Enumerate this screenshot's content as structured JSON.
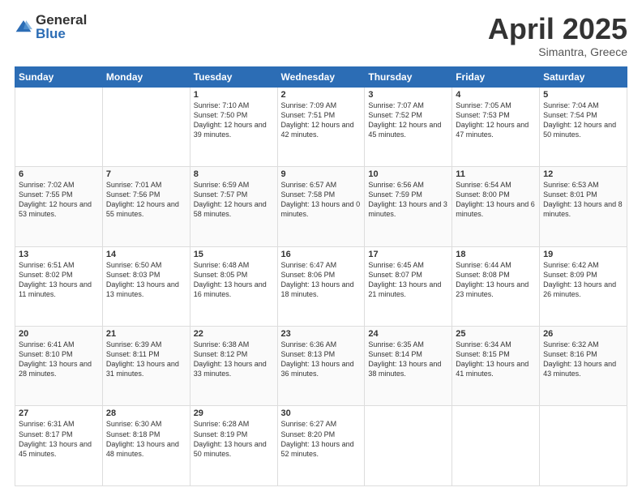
{
  "header": {
    "logo_general": "General",
    "logo_blue": "Blue",
    "title": "April 2025",
    "location": "Simantra, Greece"
  },
  "days_of_week": [
    "Sunday",
    "Monday",
    "Tuesday",
    "Wednesday",
    "Thursday",
    "Friday",
    "Saturday"
  ],
  "weeks": [
    [
      {
        "day": "",
        "info": ""
      },
      {
        "day": "",
        "info": ""
      },
      {
        "day": "1",
        "info": "Sunrise: 7:10 AM\nSunset: 7:50 PM\nDaylight: 12 hours and 39 minutes."
      },
      {
        "day": "2",
        "info": "Sunrise: 7:09 AM\nSunset: 7:51 PM\nDaylight: 12 hours and 42 minutes."
      },
      {
        "day": "3",
        "info": "Sunrise: 7:07 AM\nSunset: 7:52 PM\nDaylight: 12 hours and 45 minutes."
      },
      {
        "day": "4",
        "info": "Sunrise: 7:05 AM\nSunset: 7:53 PM\nDaylight: 12 hours and 47 minutes."
      },
      {
        "day": "5",
        "info": "Sunrise: 7:04 AM\nSunset: 7:54 PM\nDaylight: 12 hours and 50 minutes."
      }
    ],
    [
      {
        "day": "6",
        "info": "Sunrise: 7:02 AM\nSunset: 7:55 PM\nDaylight: 12 hours and 53 minutes."
      },
      {
        "day": "7",
        "info": "Sunrise: 7:01 AM\nSunset: 7:56 PM\nDaylight: 12 hours and 55 minutes."
      },
      {
        "day": "8",
        "info": "Sunrise: 6:59 AM\nSunset: 7:57 PM\nDaylight: 12 hours and 58 minutes."
      },
      {
        "day": "9",
        "info": "Sunrise: 6:57 AM\nSunset: 7:58 PM\nDaylight: 13 hours and 0 minutes."
      },
      {
        "day": "10",
        "info": "Sunrise: 6:56 AM\nSunset: 7:59 PM\nDaylight: 13 hours and 3 minutes."
      },
      {
        "day": "11",
        "info": "Sunrise: 6:54 AM\nSunset: 8:00 PM\nDaylight: 13 hours and 6 minutes."
      },
      {
        "day": "12",
        "info": "Sunrise: 6:53 AM\nSunset: 8:01 PM\nDaylight: 13 hours and 8 minutes."
      }
    ],
    [
      {
        "day": "13",
        "info": "Sunrise: 6:51 AM\nSunset: 8:02 PM\nDaylight: 13 hours and 11 minutes."
      },
      {
        "day": "14",
        "info": "Sunrise: 6:50 AM\nSunset: 8:03 PM\nDaylight: 13 hours and 13 minutes."
      },
      {
        "day": "15",
        "info": "Sunrise: 6:48 AM\nSunset: 8:05 PM\nDaylight: 13 hours and 16 minutes."
      },
      {
        "day": "16",
        "info": "Sunrise: 6:47 AM\nSunset: 8:06 PM\nDaylight: 13 hours and 18 minutes."
      },
      {
        "day": "17",
        "info": "Sunrise: 6:45 AM\nSunset: 8:07 PM\nDaylight: 13 hours and 21 minutes."
      },
      {
        "day": "18",
        "info": "Sunrise: 6:44 AM\nSunset: 8:08 PM\nDaylight: 13 hours and 23 minutes."
      },
      {
        "day": "19",
        "info": "Sunrise: 6:42 AM\nSunset: 8:09 PM\nDaylight: 13 hours and 26 minutes."
      }
    ],
    [
      {
        "day": "20",
        "info": "Sunrise: 6:41 AM\nSunset: 8:10 PM\nDaylight: 13 hours and 28 minutes."
      },
      {
        "day": "21",
        "info": "Sunrise: 6:39 AM\nSunset: 8:11 PM\nDaylight: 13 hours and 31 minutes."
      },
      {
        "day": "22",
        "info": "Sunrise: 6:38 AM\nSunset: 8:12 PM\nDaylight: 13 hours and 33 minutes."
      },
      {
        "day": "23",
        "info": "Sunrise: 6:36 AM\nSunset: 8:13 PM\nDaylight: 13 hours and 36 minutes."
      },
      {
        "day": "24",
        "info": "Sunrise: 6:35 AM\nSunset: 8:14 PM\nDaylight: 13 hours and 38 minutes."
      },
      {
        "day": "25",
        "info": "Sunrise: 6:34 AM\nSunset: 8:15 PM\nDaylight: 13 hours and 41 minutes."
      },
      {
        "day": "26",
        "info": "Sunrise: 6:32 AM\nSunset: 8:16 PM\nDaylight: 13 hours and 43 minutes."
      }
    ],
    [
      {
        "day": "27",
        "info": "Sunrise: 6:31 AM\nSunset: 8:17 PM\nDaylight: 13 hours and 45 minutes."
      },
      {
        "day": "28",
        "info": "Sunrise: 6:30 AM\nSunset: 8:18 PM\nDaylight: 13 hours and 48 minutes."
      },
      {
        "day": "29",
        "info": "Sunrise: 6:28 AM\nSunset: 8:19 PM\nDaylight: 13 hours and 50 minutes."
      },
      {
        "day": "30",
        "info": "Sunrise: 6:27 AM\nSunset: 8:20 PM\nDaylight: 13 hours and 52 minutes."
      },
      {
        "day": "",
        "info": ""
      },
      {
        "day": "",
        "info": ""
      },
      {
        "day": "",
        "info": ""
      }
    ]
  ]
}
